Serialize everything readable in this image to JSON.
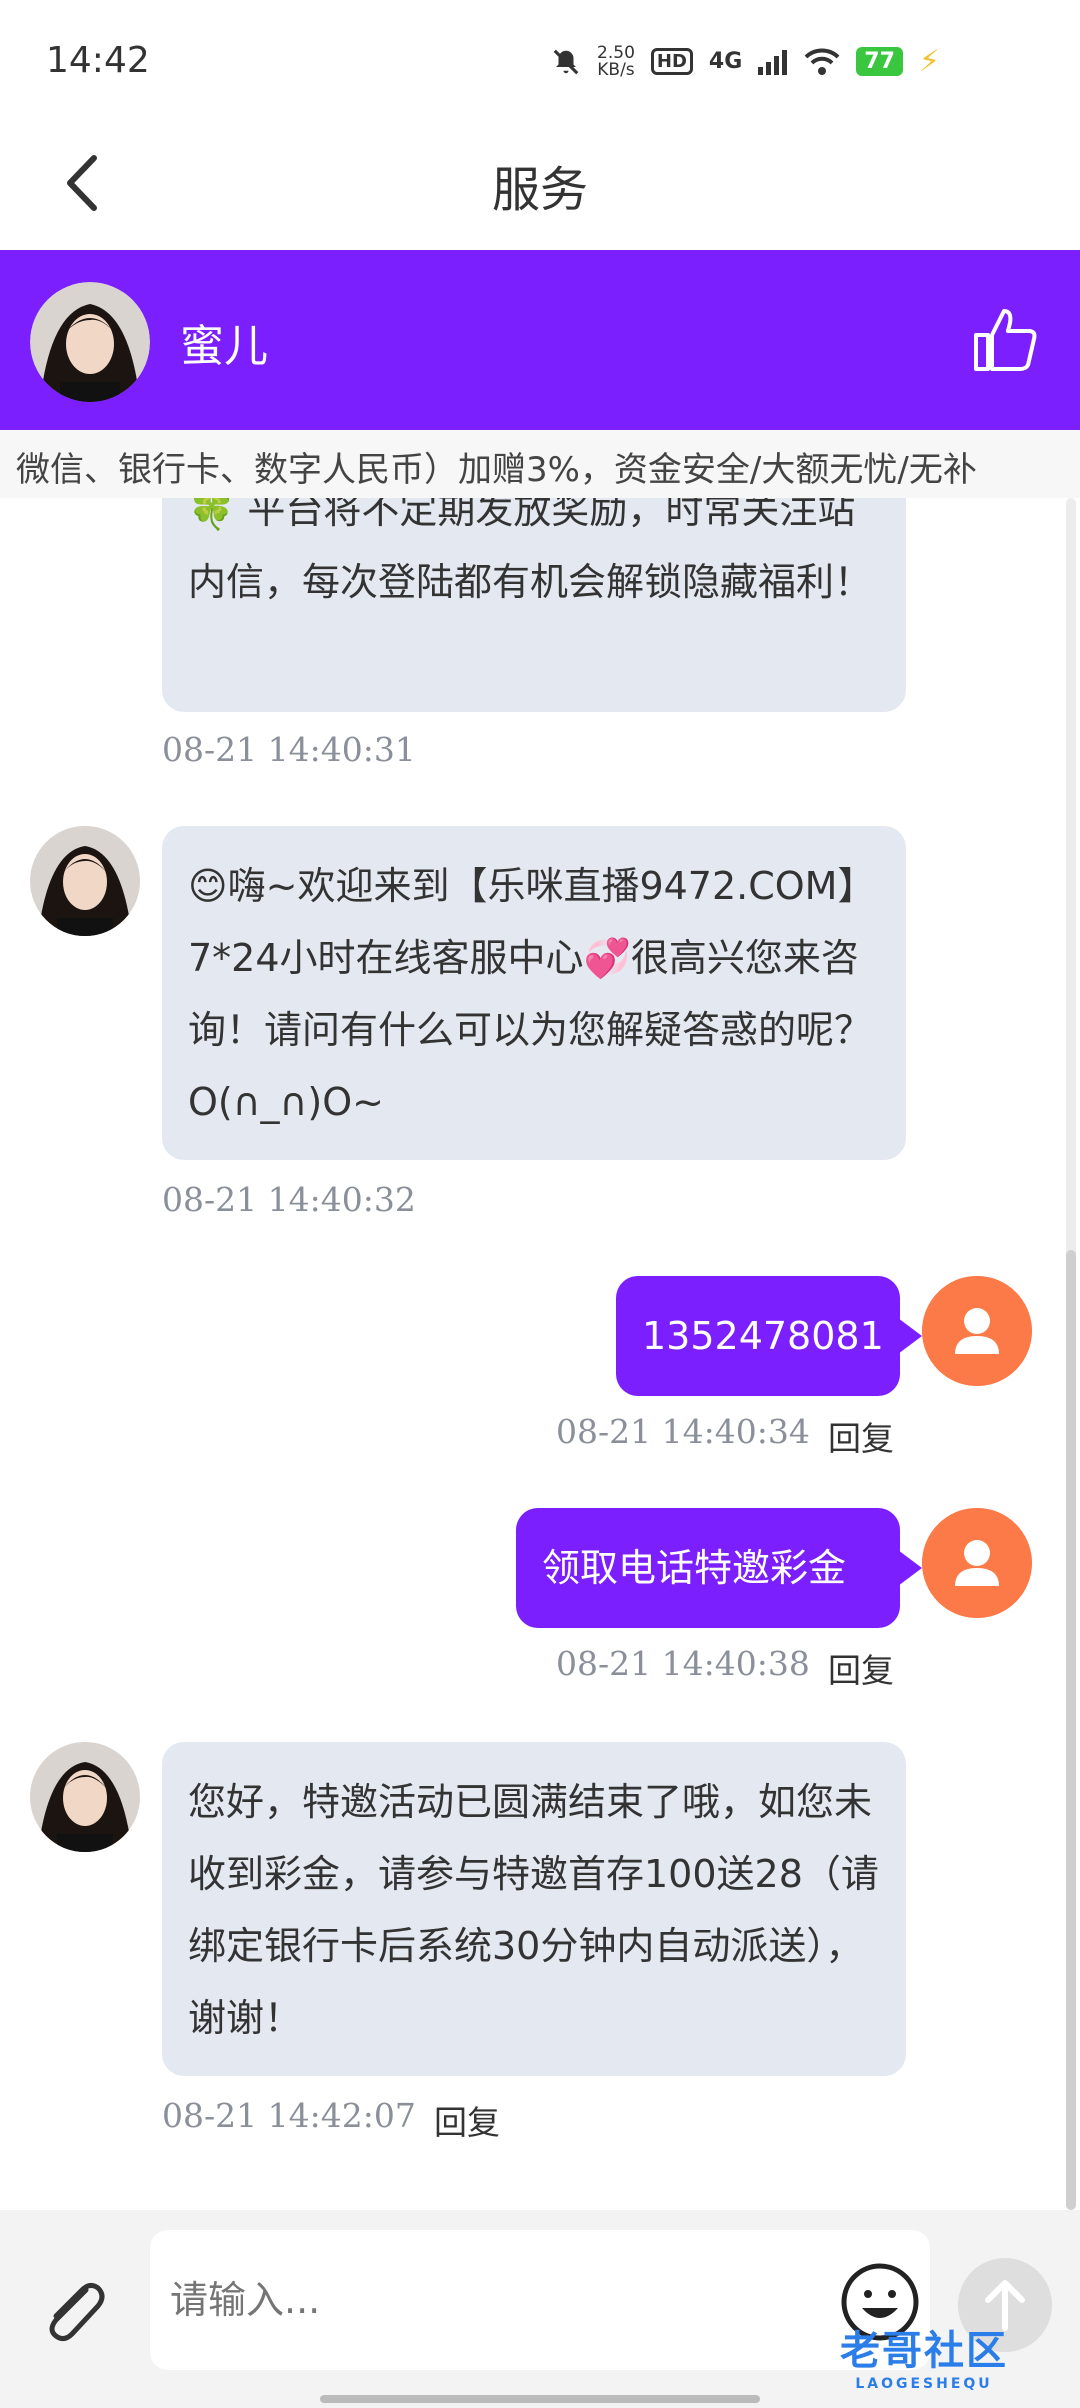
{
  "status_bar": {
    "time": "14:42",
    "speed_value": "2.50",
    "speed_unit": "KB/s",
    "hd": "HD",
    "network": "4G",
    "battery": "77"
  },
  "header": {
    "title": "服务"
  },
  "agent": {
    "name": "蜜儿"
  },
  "marquee": {
    "text": "微信、银行卡、数字人民币）加赠3%，资金安全/大额无忧/无补"
  },
  "messages": [
    {
      "from": "agent",
      "text": "🍀 平台将不定期发放奖励，时常关注站内信，每次登陆都有机会解锁隐藏福利！",
      "time": "08-21 14:40:31"
    },
    {
      "from": "agent",
      "text": "😊嗨~欢迎来到【乐咪直播9472.COM】7*24小时在线客服中心💞很高兴您来咨询！请问有什么可以为您解疑答惑的呢？O(∩_∩)O~",
      "time": "08-21 14:40:32"
    },
    {
      "from": "user",
      "text": "1352478081",
      "time": "08-21 14:40:34",
      "reply": "回复"
    },
    {
      "from": "user",
      "text": "领取电话特邀彩金",
      "time": "08-21 14:40:38",
      "reply": "回复"
    },
    {
      "from": "agent",
      "text": "您好，特邀活动已圆满结束了哦，如您未收到彩金，请参与特邀首存100送28（请绑定银行卡后系统30分钟内自动派送），谢谢！",
      "time": "08-21 14:42:07",
      "reply": "回复"
    }
  ],
  "input": {
    "placeholder": "请输入..."
  },
  "watermark": {
    "text": "老哥社区",
    "sub": "LAOGESHEQU"
  },
  "colors": {
    "brand": "#7b1fff",
    "agent_bubble": "#e4e8f1",
    "user_avatar": "#fb7a48"
  }
}
